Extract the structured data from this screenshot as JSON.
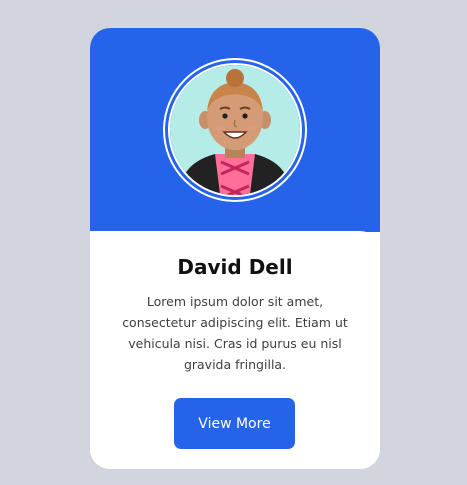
{
  "profile": {
    "name": "David Dell",
    "bio": "Lorem ipsum dolor sit amet, consectetur adipiscing elit. Etiam ut vehicula nisi. Cras id purus eu nisl gravida fringilla.",
    "button_label": "View More",
    "avatar_icon": "person-avatar-icon"
  },
  "colors": {
    "accent": "#2563eb",
    "background": "#d2d5dd",
    "card": "#ffffff"
  }
}
